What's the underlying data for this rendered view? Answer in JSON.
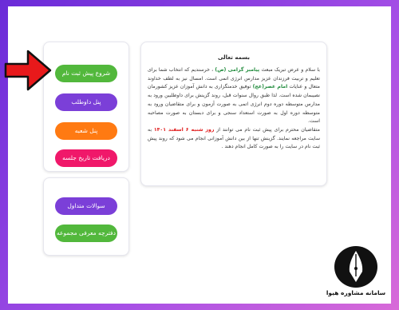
{
  "colors": {
    "green": "#52b83c",
    "purple": "#7b3fd8",
    "orange": "#ff7a12",
    "pink": "#f0186a",
    "arrow_red": "#e8191b"
  },
  "buttons_top": [
    {
      "label": "شروع پیش ثبت نام",
      "color": "#52b83c"
    },
    {
      "label": "پنل داوطلب",
      "color": "#7b3fd8"
    },
    {
      "label": "پنل شعبه",
      "color": "#ff7a12"
    },
    {
      "label": "دریافت تاریخ جلسه",
      "color": "#f0186a"
    }
  ],
  "buttons_bottom": [
    {
      "label": "سوالات متداول",
      "color": "#7b3fd8"
    },
    {
      "label": "دفترچه معرفی مجموعه",
      "color": "#52b83c"
    }
  ],
  "info": {
    "title": "بسمه تعالی",
    "p1_a": "با سلام و عرض تبریک مبعث ",
    "p1_prophet": "پیامبر گرامی (ص)",
    "p1_b": " ، خرسندیم که انتخاب شما برای تعلیم و تربیت فرزندان عزیز مدارس انرژی اتمی است. امسال نیز به لطف خداوند متعال و عنایات ",
    "p1_imam": "امام عصر(عج)",
    "p1_c": " توفیق خدمتگزاری به دانش آموزان عزیز کشورمان نصیبمان شده است. لذا طبق روال سنوات قبل، روند گزینش برای داوطلبین ورود به مدارس متوسطه دوره دوم انرژی اتمی به صورت آزمون و برای متقاضیان ورود به متوسطه دوره اول به صورت استعداد سنجی و برای دبستان به صورت مصاحبه است.",
    "p2_a": "متقاضیان محترم برای پیش ثبت نام می توانند از ",
    "p2_date": "روز شنبه ۶ اسفند ۱۴۰۱",
    "p2_b": " به سایت مراجعه نمایند. گزینش تنها از بین دانش آموزانی انجام می شود که روند پیش ثبت نام در سایت را به صورت کامل انجام دهند ."
  },
  "logo": {
    "text": "سامانه مشاوره هیوا"
  }
}
